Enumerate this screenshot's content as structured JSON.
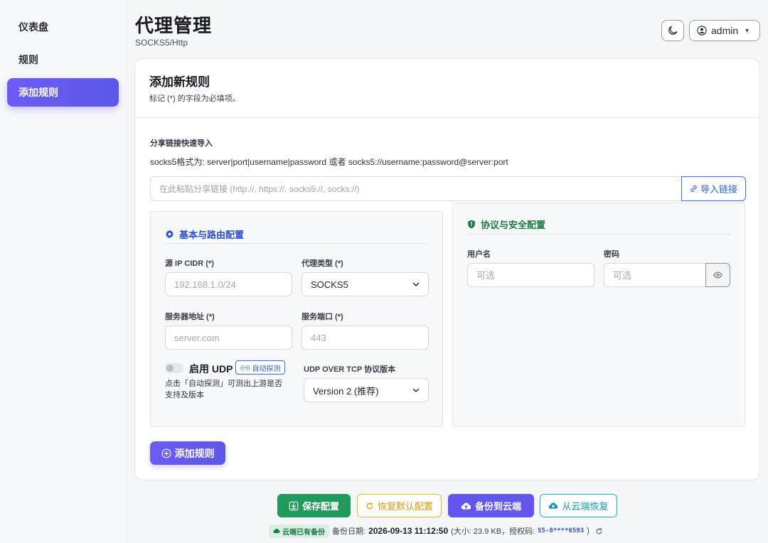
{
  "sidebar": {
    "items": [
      {
        "label": "仪表盘",
        "active": false
      },
      {
        "label": "规则",
        "active": false
      },
      {
        "label": "添加规则",
        "active": true
      }
    ]
  },
  "header": {
    "title": "代理管理",
    "subtitle": "SOCKS5/Http",
    "theme_icon": "moon-icon",
    "user_label": "admin"
  },
  "card": {
    "title": "添加新规则",
    "description": "标记 (*) 的字段为必填项。",
    "import_section": {
      "label": "分享链接快速导入",
      "format_hint": "socks5格式为: server|port|username|password 或者 socks5://username:password@server:port",
      "input_placeholder": "在此粘贴分享链接 (http://, https://, socks5://, socks://)",
      "button_label": "导入链接"
    },
    "basic_panel": {
      "heading": "基本与路由配置",
      "source_label": "源 IP CIDR (*)",
      "source_placeholder": "192.168.1.0/24",
      "proxy_type_label": "代理类型 (*)",
      "proxy_type_value": "SOCKS5",
      "server_label": "服务器地址 (*)",
      "server_placeholder": "server.com",
      "port_label": "服务端口 (*)",
      "port_placeholder": "443",
      "udp_label": "启用 UDP",
      "udp_enabled": false,
      "detect_button": "自动探测",
      "udp_hint": "点击「自动探测」可测出上游是否支持及版本",
      "udp_version_label": "UDP OVER TCP 协议版本",
      "udp_version_value": "Version 2 (推荐)"
    },
    "security_panel": {
      "heading": "协议与安全配置",
      "username_label": "用户名",
      "username_placeholder": "可选",
      "password_label": "密码",
      "password_placeholder": "可选"
    },
    "submit_label": "添加规则"
  },
  "footer": {
    "save_label": "保存配置",
    "reset_label": "恢复默认配置",
    "backup_label": "备份到云端",
    "restore_label": "从云端恢复",
    "cloud_badge": "云端已有备份",
    "backup_date_prefix": "备份日期:",
    "backup_date": "2026-09-13 11:12:50",
    "backup_size": "(大小: 23.9 KB，授权码:",
    "auth_code": "S5-8****6593",
    "close_paren": ")"
  },
  "colors": {
    "accent": "#6356ec",
    "success": "#1f9a5c",
    "warning": "#d49a10",
    "info": "#1596ad",
    "link": "#2f5fe0"
  }
}
